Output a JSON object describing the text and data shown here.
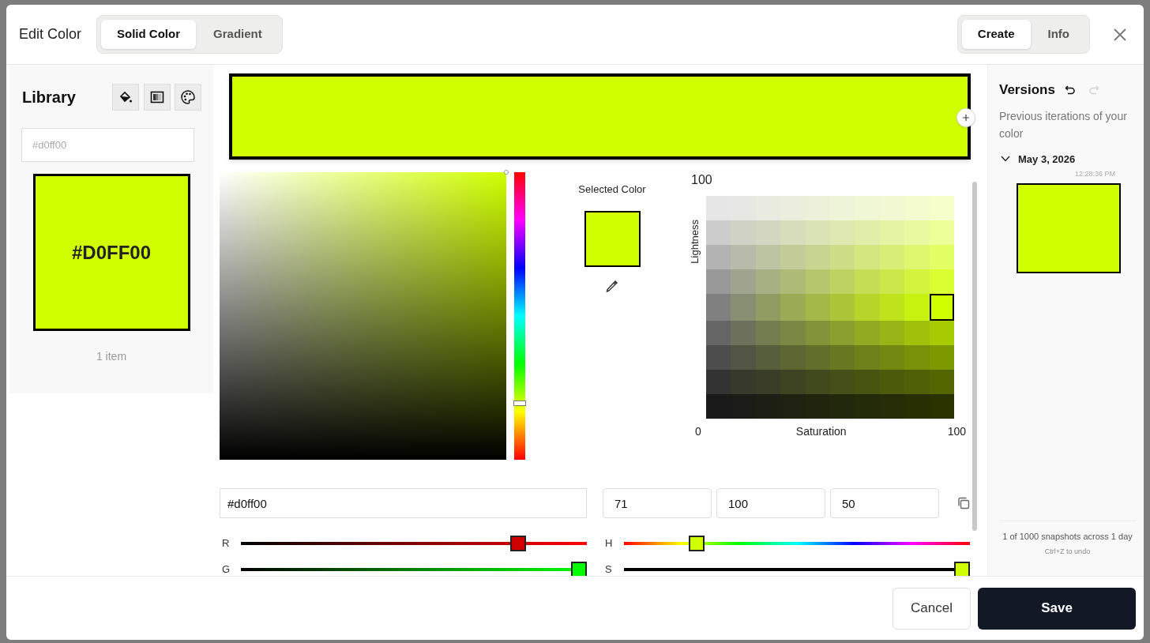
{
  "header": {
    "title": "Edit Color",
    "mode_tabs": [
      {
        "label": "Solid Color",
        "selected": true
      },
      {
        "label": "Gradient",
        "selected": false
      }
    ],
    "view_tabs": [
      {
        "label": "Create",
        "selected": true
      },
      {
        "label": "Info",
        "selected": false
      }
    ]
  },
  "library": {
    "title": "Library",
    "search": {
      "placeholder": "#d0ff00"
    },
    "swatches": [
      {
        "label": "#D0FF00",
        "color": "#d0ff00"
      }
    ],
    "count": "1 item"
  },
  "hue_strip": {
    "level": 0.197
  },
  "selected_color": {
    "label": "Selected Color"
  },
  "grid": {
    "y_max": "100",
    "ylabel": "Lightness",
    "x_min": "0",
    "xlabel": "Saturation",
    "x_max": "100"
  },
  "hex_field": {
    "value": "#d0ff00"
  },
  "hsl_fields": [
    {
      "value": "71"
    },
    {
      "value": "100"
    },
    {
      "value": "50"
    }
  ],
  "rgb_sliders": [
    {
      "label": "R",
      "kind": "red",
      "level": 0.816
    },
    {
      "label": "G",
      "kind": "green",
      "level": 1
    }
  ],
  "hsl_sliders": [
    {
      "label": "H",
      "kind": "hue",
      "level": 0.197
    },
    {
      "label": "S",
      "kind": "saturation",
      "level": 1
    }
  ],
  "versions": {
    "title": "Versions",
    "redo_disabled": true,
    "subtitle": "Previous iterations of your color",
    "groups": [
      {
        "date": "May 3, 2026",
        "expanded": true,
        "items": [
          {
            "time": "12:28:36 PM",
            "color": "#d0ff00"
          }
        ]
      }
    ],
    "summary": "1 of 1000 snapshots across 1 day",
    "hint": "Ctrl+Z to undo"
  },
  "footer": {
    "cancel": "Cancel",
    "save": "Save"
  }
}
